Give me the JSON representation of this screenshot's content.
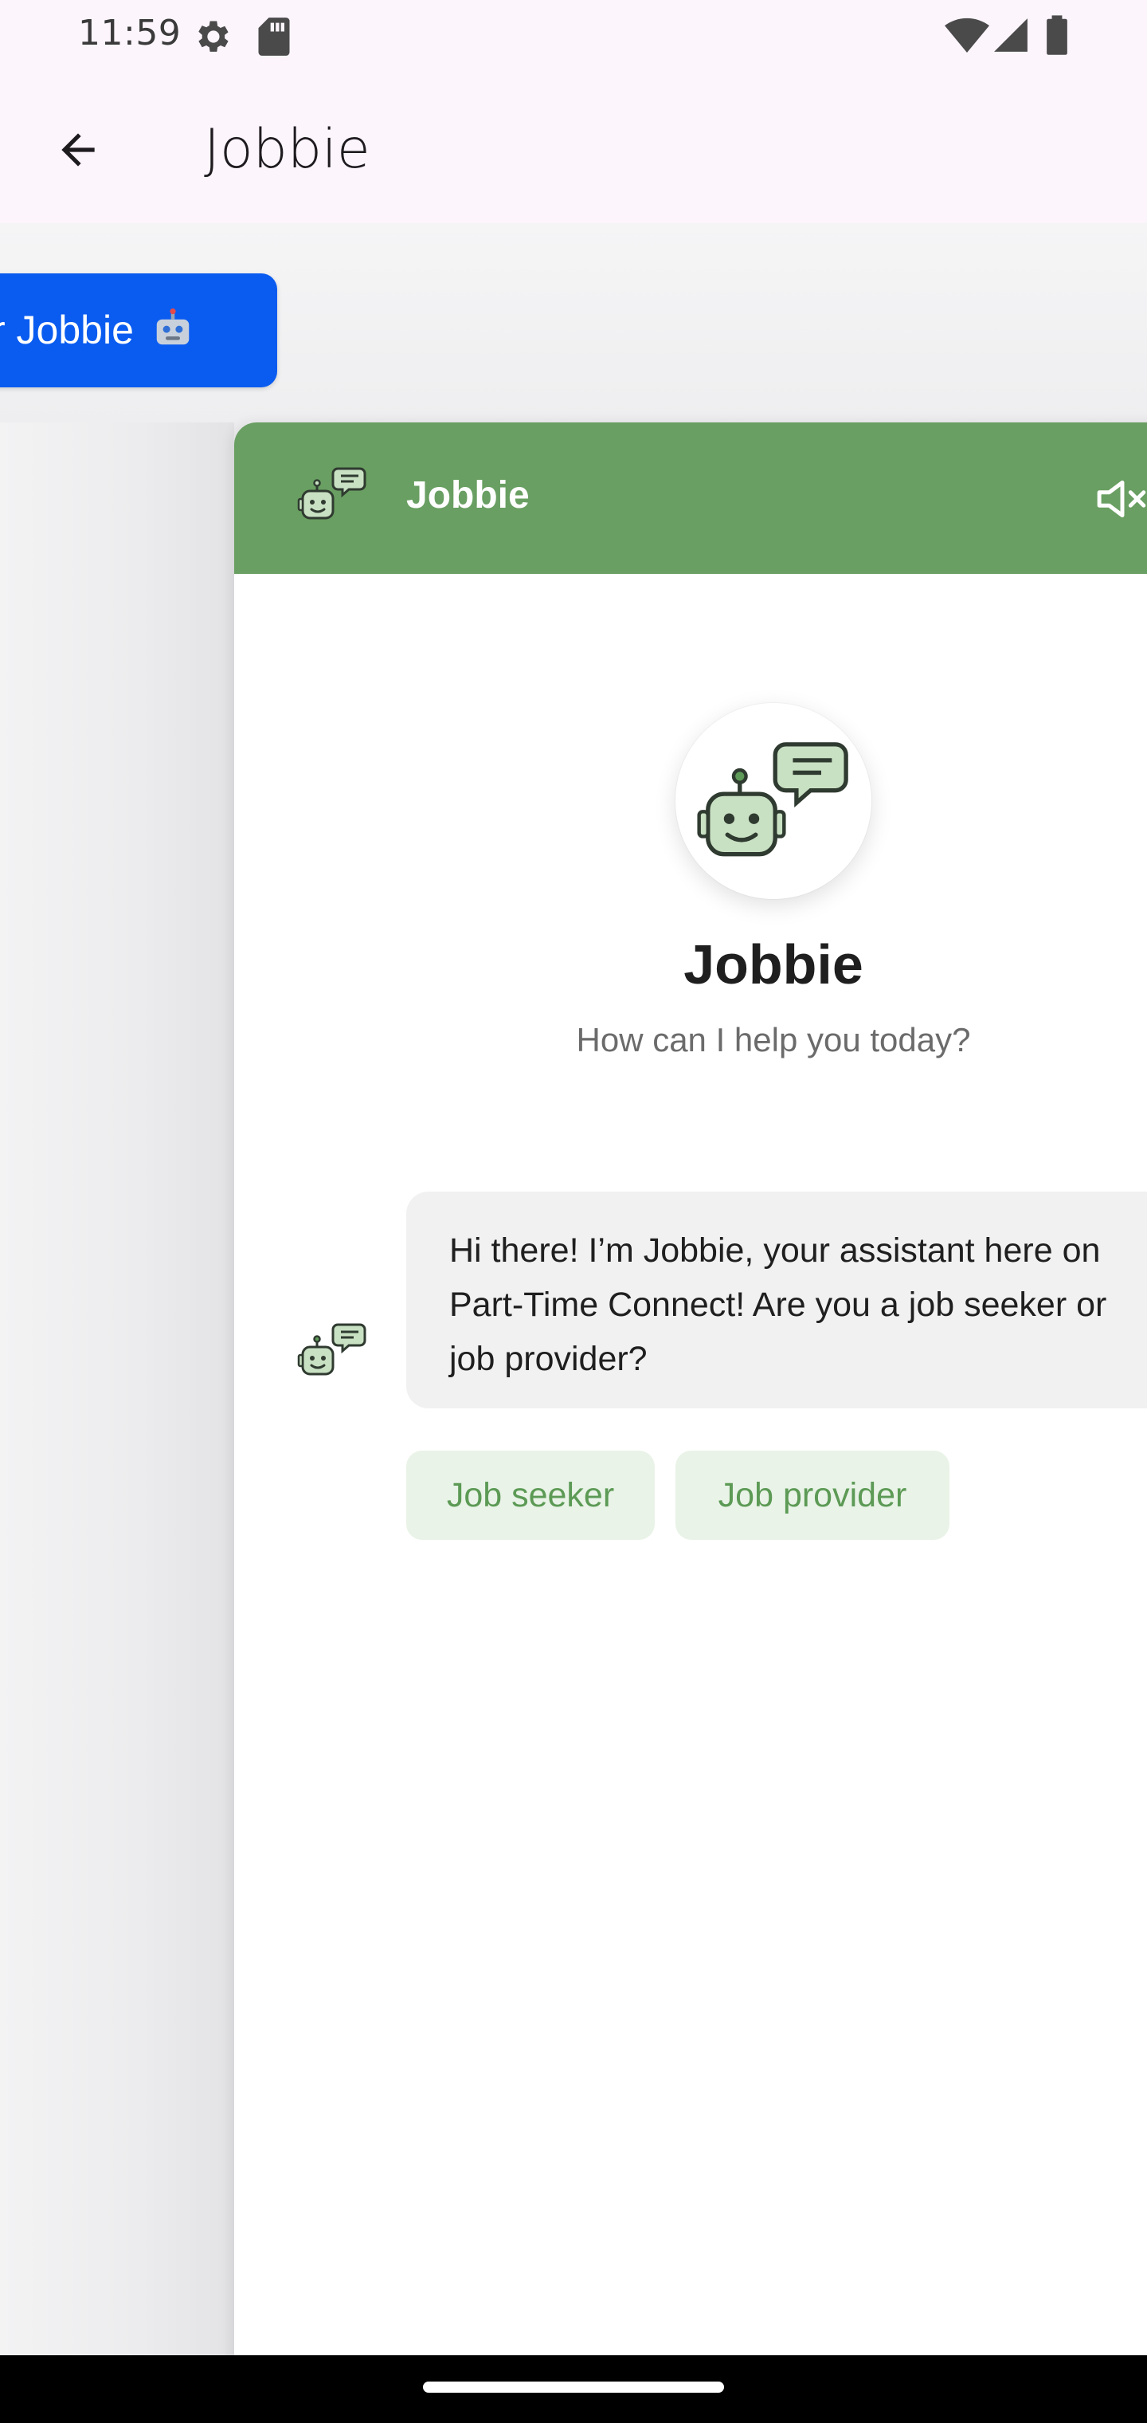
{
  "status_bar": {
    "time": "11:59",
    "icons": [
      "settings-gear-icon",
      "sd-card-icon",
      "wifi-icon",
      "cell-signal-icon",
      "battery-icon"
    ]
  },
  "app_bar": {
    "back_icon": "arrow-back-icon",
    "title": "Jobbie"
  },
  "open_chat_button": {
    "label": "r Jobbie",
    "icon": "robot-emoji-icon",
    "color": "#0a5cf0"
  },
  "chat_widget": {
    "header": {
      "title": "Jobbie",
      "bot_icon": "robot-chat-icon",
      "mute_icon": "speaker-muted-icon",
      "color": "#699f62"
    },
    "welcome": {
      "title": "Jobbie",
      "subtitle": "How can I help you today?"
    },
    "messages": [
      {
        "sender": "bot",
        "text": "Hi there! I’m Jobbie, your assistant here on\nPart-Time Connect! Are you a job seeker or\njob provider?"
      }
    ],
    "quick_replies": [
      "Job seeker",
      "Job provider"
    ],
    "chip_bg": "#e9f3e7",
    "chip_text": "#5c9a55"
  }
}
